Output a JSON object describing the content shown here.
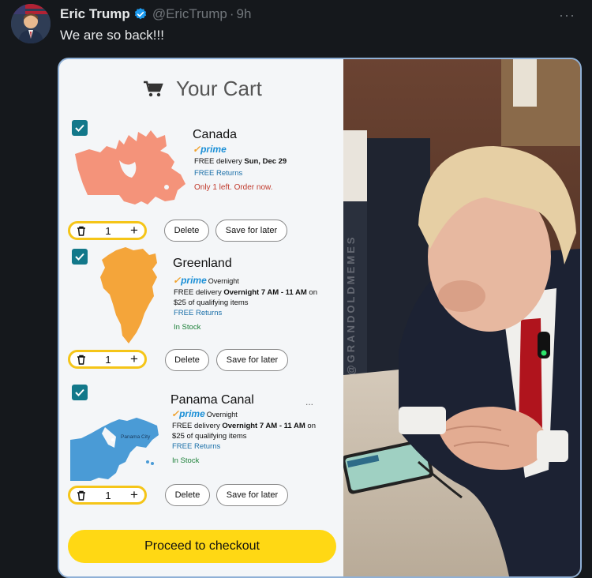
{
  "tweet": {
    "author_name": "Eric Trump",
    "handle": "@EricTrump",
    "separator": "·",
    "time": "9h",
    "text": "We are so back!!!",
    "more_icon": "more-horizontal-icon"
  },
  "cart": {
    "title": "Your Cart",
    "items": [
      {
        "name": "Canada",
        "prime": "prime",
        "prime_suffix": "",
        "delivery_prefix": "FREE delivery ",
        "delivery_bold": "Sun, Dec 29",
        "delivery_suffix": "",
        "delivery_line2": "",
        "returns": "FREE Returns",
        "stock": "Only 1 left. Order now.",
        "qty": "1",
        "delete": "Delete",
        "save": "Save for later",
        "map_color": "#f4937a"
      },
      {
        "name": "Greenland",
        "prime": "prime",
        "prime_suffix": "Overnight",
        "delivery_prefix": "FREE delivery ",
        "delivery_bold": "Overnight 7 AM - 11 AM",
        "delivery_suffix": " on",
        "delivery_line2": "$25 of qualifying items",
        "returns": "FREE Returns",
        "stock": "In Stock",
        "qty": "1",
        "delete": "Delete",
        "save": "Save for later",
        "map_color": "#f4a53a"
      },
      {
        "name": "Panama Canal",
        "prime": "prime",
        "prime_suffix": "Overnight",
        "delivery_prefix": "FREE delivery ",
        "delivery_bold": "Overnight 7 AM - 11 AM",
        "delivery_suffix": " on",
        "delivery_line2": "$25 of qualifying items",
        "returns": "FREE Returns",
        "stock": "In Stock",
        "qty": "1",
        "delete": "Delete",
        "save": "Save for later",
        "map_label": "Panama City",
        "more": "...",
        "map_color": "#4a9bd6"
      }
    ],
    "checkout": "Proceed to checkout"
  },
  "photo": {
    "watermark": "@GRANDOLDMEMES"
  },
  "colors": {
    "checkout_yellow": "#ffd814",
    "checkbox_teal": "#12788a",
    "prime_blue": "#1a8fd6",
    "verified_blue": "#1d9bf0"
  }
}
